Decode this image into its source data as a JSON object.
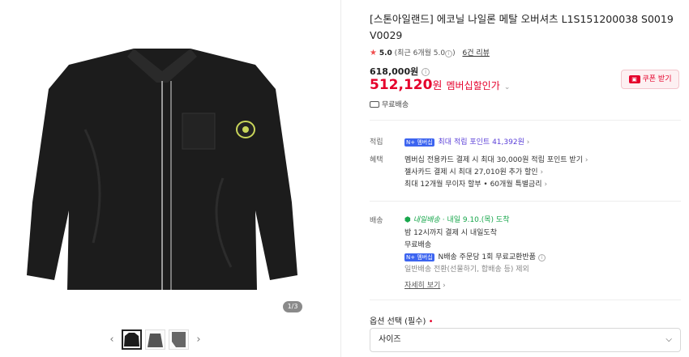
{
  "gallery": {
    "counter": "1/3",
    "prev_glyph": "‹",
    "next_glyph": "›"
  },
  "product": {
    "title": "[스톤아일랜드] 에코닐 나일론 메탈 오버셔츠 L1S151200038 S0019 V0029",
    "rating_value": "5.0",
    "rating_note": "(최근 6개월 5.0",
    "rating_note_end": ")",
    "reviews": "6건 리뷰",
    "original_price": "618,000원",
    "sale_price": "512,120",
    "sale_won": "원",
    "member_discount": "멤버십할인가",
    "coupon_label": "쿠폰 받기",
    "free_shipping": "무료배송"
  },
  "benefits": {
    "points_label": "적립",
    "points_badge": "N+ 멤버십",
    "points_text": "최대 적립 포인트 41,392원",
    "perks_label": "혜택",
    "perks": [
      "멤버십 전용카드 결제 시 최대 30,000원 적립 포인트 받기",
      "젤사카드 결제 시 최대 27,010원 추가 할인",
      "최대 12개월 무이자 할부 • 60개월 특별금리"
    ]
  },
  "delivery": {
    "label": "배송",
    "tomorrow_badge": "내일배송",
    "tomorrow_text": "· 내일 9.10.(목) 도착",
    "cutoff": "밤 12시까지 결제 시 내일도착",
    "free": "무료배송",
    "n_return": "N배송 주문당 1회 무료교환반품",
    "normal": "일반배송 전환(선물하기, 합배송 등) 제외",
    "detail_link": "자세히 보기"
  },
  "options": {
    "label": "옵션 선택 (필수)",
    "required_mark": "•",
    "select_placeholder": "사이즈"
  },
  "colors": {
    "accent_red": "#e5002b",
    "npay_blue": "#3c64f0",
    "points_purple": "#5a3fd8",
    "delivery_green": "#18a74c"
  }
}
